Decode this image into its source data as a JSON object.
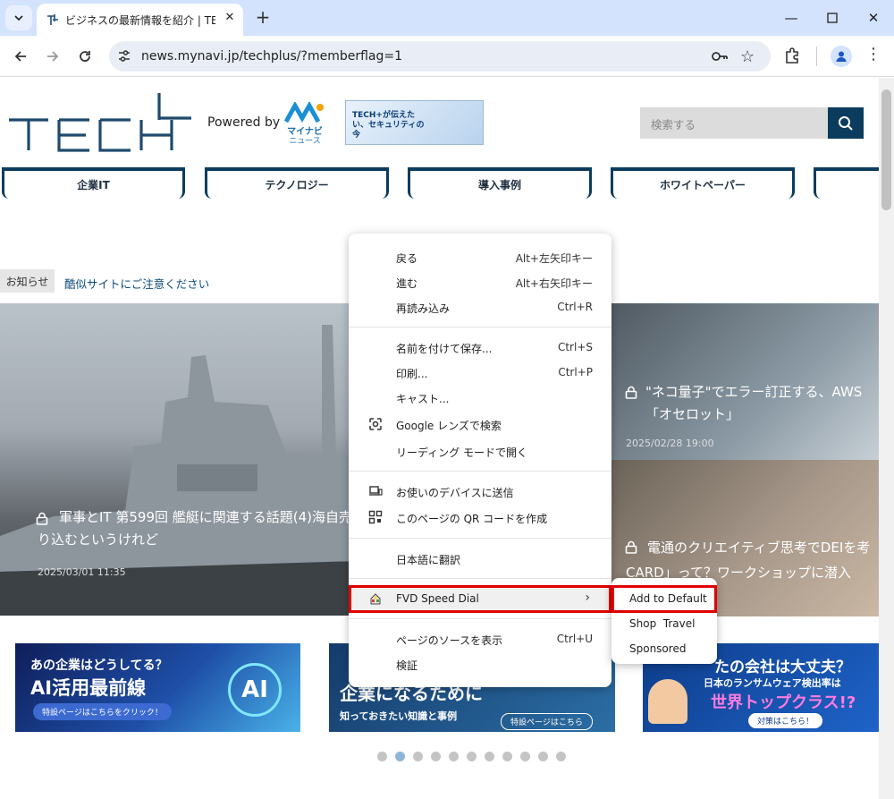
{
  "browser": {
    "tab_title": "ビジネスの最新情報を紹介 | TECH+",
    "url": "news.mynavi.jp/techplus/?memberflag=1"
  },
  "site": {
    "logo_text": "TECH+",
    "powered_by": "Powered by",
    "mynavi_text_1": "マイナビ",
    "mynavi_text_2": "ニュース",
    "top_banner_text": "TECH+が伝えたい、セキュリティの今",
    "search_placeholder": "検索する",
    "nav": [
      "企業IT",
      "テクノロジー",
      "導入事例",
      "ホワイトペーパー"
    ],
    "notice_label": "お知らせ",
    "notice_text": "酷似サイトにご注意ください"
  },
  "articles": {
    "hero_title": "軍事とIT 第599回 艦艇に関連する話題(4)海自売り込むというけれど",
    "hero_date": "2025/03/01 11:35",
    "card1_title": "\"ネコ量子\"でエラー訂正する、AWS「オセロット」",
    "card1_date": "2025/02/28 19:00",
    "card2_title": "電通のクリエイティブ思考でDEIを考CARD」って？ワークショップに潜入"
  },
  "banners": {
    "b1_line1": "あの企業はどうしてる？",
    "b1_line2": "AI活用最前線",
    "b1_cta": "特設ページはこちらをクリック！",
    "b2_line1": "企業になるために",
    "b2_line2": "知っておきたい知識と事例",
    "b2_cta": "特設ページはこちら",
    "b3_line1": "たの会社は大丈夫？",
    "b3_line2": "日本のランサムウェア検出率は",
    "b3_line3": "世界トップクラス!?",
    "b3_cta": "対策はこちら！"
  },
  "context_menu": {
    "back": "戻る",
    "back_sc": "Alt+左矢印キー",
    "forward": "進む",
    "forward_sc": "Alt+右矢印キー",
    "reload": "再読み込み",
    "reload_sc": "Ctrl+R",
    "save": "名前を付けて保存...",
    "save_sc": "Ctrl+S",
    "print": "印刷...",
    "print_sc": "Ctrl+P",
    "cast": "キャスト...",
    "lens": "Google レンズで検索",
    "reading": "リーディング モードで開く",
    "send": "お使いのデバイスに送信",
    "qr": "このページの QR コードを作成",
    "translate": "日本語に翻訳",
    "fvd": "FVD Speed Dial",
    "source": "ページのソースを表示",
    "source_sc": "Ctrl+U",
    "inspect": "検証"
  },
  "submenu": [
    "Add to Default",
    "Shop  Travel",
    "Sponsored"
  ],
  "carousel": {
    "count": 11,
    "active": 1
  }
}
